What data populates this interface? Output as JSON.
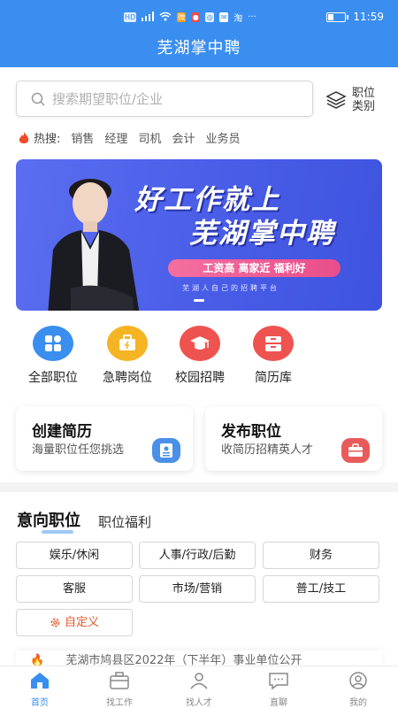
{
  "status_bar": {
    "left_icons": [
      "HD",
      "signal",
      "wifi",
      "weibo",
      "app",
      "app",
      "wechat",
      "taobao",
      "more"
    ],
    "time": "11:59"
  },
  "app": {
    "title": "芜湖掌中聘"
  },
  "search": {
    "placeholder": "搜索期望职位/企业"
  },
  "job_category": {
    "label": "职位类别",
    "icon": "layers-icon"
  },
  "hot_search": {
    "label": "热搜:",
    "keywords": [
      "销售",
      "经理",
      "司机",
      "会计",
      "业务员"
    ]
  },
  "banner": {
    "headline_1": "好工作就上",
    "headline_2": "芜湖掌中聘",
    "pill": "工资高  离家近  福利好",
    "subtitle": "芜湖人自己的招聘平台"
  },
  "quick_links": [
    {
      "label": "全部职位",
      "icon": "grid-icon",
      "color": "#3a8ef0"
    },
    {
      "label": "急聘岗位",
      "icon": "urgent-bag-icon",
      "color": "#f5b423"
    },
    {
      "label": "校园招聘",
      "icon": "graduation-cap-icon",
      "color": "#ee5350"
    },
    {
      "label": "简历库",
      "icon": "resume-box-icon",
      "color": "#ee5350"
    }
  ],
  "cards": [
    {
      "title": "创建简历",
      "subtitle": "海量职位任您挑选",
      "icon": "resume-icon",
      "color": "#4a90e8"
    },
    {
      "title": "发布职位",
      "subtitle": "收简历招精英人才",
      "icon": "briefcase-icon",
      "color": "#e95a5a"
    }
  ],
  "tabs": [
    "意向职位",
    "职位福利"
  ],
  "tags": [
    "娱乐/休闲",
    "人事/行政/后勤",
    "财务",
    "客服",
    "市场/营销",
    "普工/技工"
  ],
  "custom_tag": "自定义",
  "news": "芜湖市鸠县区2022年（下半年）事业单位公开",
  "bottom_nav": [
    {
      "label": "首页",
      "icon": "home-icon",
      "active": true
    },
    {
      "label": "找工作",
      "icon": "briefcase-icon",
      "active": false
    },
    {
      "label": "找人才",
      "icon": "people-icon",
      "active": false
    },
    {
      "label": "直聊",
      "icon": "chat-icon",
      "active": false
    },
    {
      "label": "我的",
      "icon": "user-icon",
      "active": false
    }
  ]
}
